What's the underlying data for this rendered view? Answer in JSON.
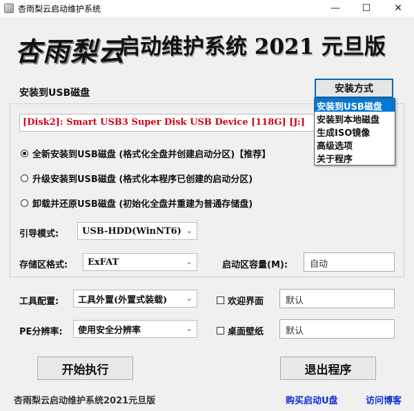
{
  "window": {
    "title": "杏雨梨云启动维护系统"
  },
  "banner": {
    "logo_text": "杏雨梨云",
    "title": "启动维护系统 2021 元旦版"
  },
  "install_target_label": "安装到USB磁盘",
  "disk_entry": "[Disk2]:  Smart USB3 Super Disk USB Device  [118G]  [J:]",
  "install_method": {
    "label": "安装方式",
    "options": [
      "安装到USB磁盘",
      "安装到本地磁盘",
      "生成ISO镜像",
      "高级选项",
      "关于程序"
    ],
    "selected": "安装到USB磁盘"
  },
  "radios": [
    {
      "label": "全新安装到USB磁盘 (格式化全盘并创建启动分区)【推荐】",
      "checked": true
    },
    {
      "label": "升级安装到USB磁盘 (格式化本程序已创建的启动分区)",
      "checked": false
    },
    {
      "label": "卸载并还原USB磁盘 (初始化全盘并重建为普通存储盘)",
      "checked": false
    }
  ],
  "boot_mode": {
    "label": "引导模式:",
    "value": "USB-HDD(WinNT6)"
  },
  "storage_format": {
    "label": "存储区格式:",
    "value": "ExFAT"
  },
  "boot_capacity": {
    "label": "启动区容量(M):",
    "value": "自动"
  },
  "tool_config": {
    "label": "工具配置:",
    "value": "工具外置(外置式装载)"
  },
  "welcome_screen": {
    "label": "欢迎界面",
    "checked": false,
    "value": "默认"
  },
  "pe_resolution": {
    "label": "PE分辨率:",
    "value": "使用安全分辨率"
  },
  "desktop_wallpaper": {
    "label": "桌面壁纸",
    "checked": false,
    "value": "默认"
  },
  "buttons": {
    "start": "开始执行",
    "exit": "退出程序"
  },
  "footer": {
    "version": "杏雨梨云启动维护系统2021元旦版",
    "buy_link": "购买启动U盘",
    "blog_link": "访问博客"
  },
  "colors": {
    "disk_text": "#d4001a",
    "menu_selected": "#0078d7",
    "link": "#0a2dd8"
  }
}
